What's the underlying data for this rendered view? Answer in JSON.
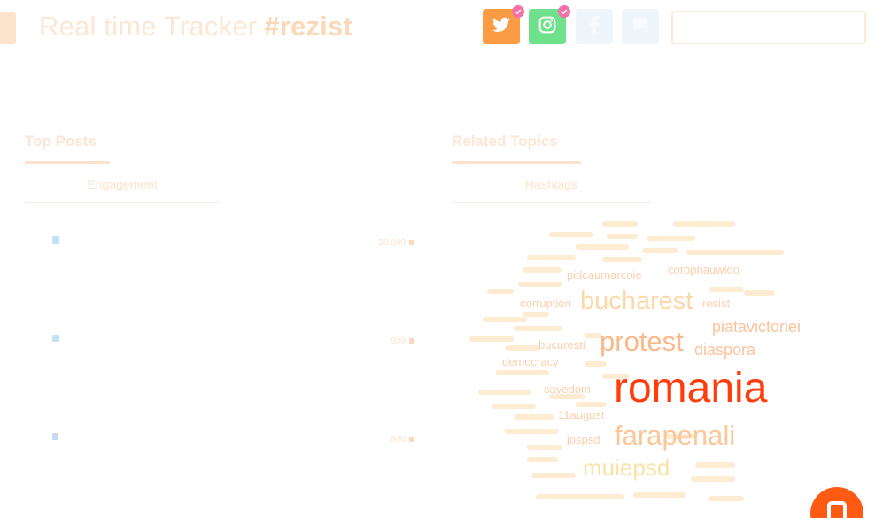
{
  "header": {
    "title_prefix": "Real time Tracker",
    "hashtag": "#rezist"
  },
  "social": [
    {
      "name": "twitter",
      "color": "#fb9b43",
      "selected": true
    },
    {
      "name": "instagram",
      "color": "#6fe18a",
      "selected": true
    },
    {
      "name": "facebook",
      "color": "#eef6fc",
      "selected": false
    },
    {
      "name": "chat",
      "color": "#eef6fc",
      "selected": false
    }
  ],
  "search": {
    "placeholder": ""
  },
  "top_posts": {
    "title": "Top Posts",
    "tab": "Engagement",
    "posts": [
      {
        "icon": "twitter-icon",
        "count": "20,000"
      },
      {
        "icon": "twitter-icon",
        "count": "900"
      },
      {
        "icon": "facebook-icon",
        "count": "800"
      }
    ]
  },
  "related_topics": {
    "title": "Related Topics",
    "tab": "Hashtags"
  },
  "word_cloud": {
    "words": [
      {
        "text": "romania",
        "size": 48,
        "color": "#ff3c0a"
      },
      {
        "text": "farapenali",
        "size": 31,
        "color": "#fbc79a"
      },
      {
        "text": "protest",
        "size": 31,
        "color": "#fbb98a"
      },
      {
        "text": "bucharest",
        "size": 29,
        "color": "#fdd7a8"
      },
      {
        "text": "muiepsd",
        "size": 26,
        "color": "#fde2a6"
      },
      {
        "text": "piatavictoriei",
        "size": 18,
        "color": "#fbc39e"
      },
      {
        "text": "diaspora",
        "size": 18,
        "color": "#fbc39e"
      },
      {
        "text": "pidcaumarcoie",
        "size": 13,
        "color": "#fbcfb0"
      },
      {
        "text": "corophauwido",
        "size": 13,
        "color": "#fbcfb0"
      },
      {
        "text": "corruption",
        "size": 13,
        "color": "#fbcfb0"
      },
      {
        "text": "resist",
        "size": 13,
        "color": "#fbcfb0"
      },
      {
        "text": "bucuresti",
        "size": 13,
        "color": "#fbcfb0"
      },
      {
        "text": "democracy",
        "size": 13,
        "color": "#fbcfb0"
      },
      {
        "text": "savedom",
        "size": 13,
        "color": "#fbcfb0"
      },
      {
        "text": "11august",
        "size": 13,
        "color": "#fbcfb0"
      },
      {
        "text": "jospsd",
        "size": 13,
        "color": "#fbcfb0"
      }
    ]
  },
  "fab": {
    "label": ""
  }
}
